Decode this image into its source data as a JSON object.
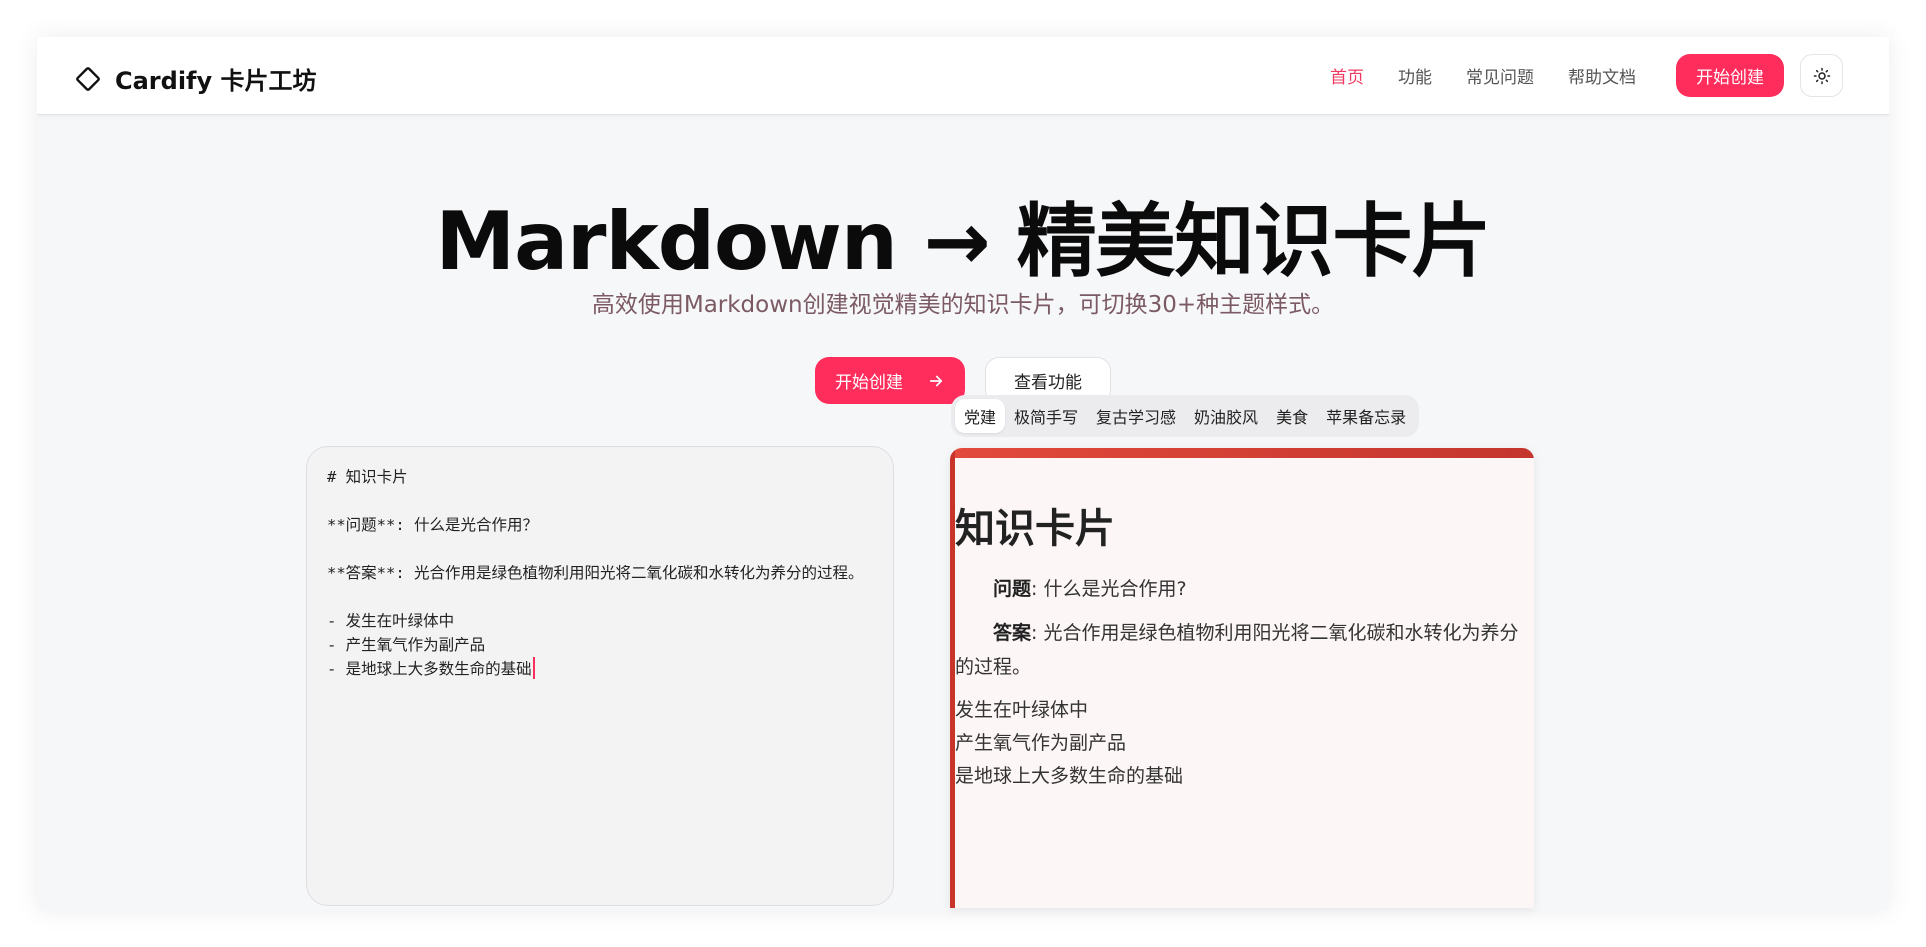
{
  "header": {
    "logo_text": "Cardify 卡片工坊",
    "nav": [
      {
        "label": "首页",
        "active": true
      },
      {
        "label": "功能",
        "active": false
      },
      {
        "label": "常见问题",
        "active": false
      },
      {
        "label": "帮助文档",
        "active": false
      }
    ],
    "cta_label": "开始创建",
    "theme_toggle_icon": "sun-icon"
  },
  "hero": {
    "title": "Markdown → 精美知识卡片",
    "subtitle": "高效使用Markdown创建视觉精美的知识卡片，可切换30+种主题样式。",
    "primary_button": "开始创建",
    "secondary_button": "查看功能"
  },
  "editor": {
    "lines": [
      "# 知识卡片",
      "",
      "**问题**: 什么是光合作用？",
      "",
      "**答案**: 光合作用是绿色植物利用阳光将二氧化碳和水转化为养分的过程。",
      "",
      "- 发生在叶绿体中",
      "- 产生氧气作为副产品",
      "- 是地球上大多数生命的基础"
    ]
  },
  "themes": {
    "tabs": [
      "党建",
      "极简手写",
      "复古学习感",
      "奶油胶风",
      "美食",
      "苹果备忘录"
    ],
    "active_index": 0
  },
  "preview": {
    "title": "知识卡片",
    "question_label": "问题",
    "question_text": ": 什么是光合作用?",
    "answer_label": "答案",
    "answer_text": ": 光合作用是绿色植物利用阳光将二氧化碳和水转化为养分的过程。",
    "bullets": [
      "发生在叶绿体中",
      "产生氧气作为副产品",
      "是地球上大多数生命的基础"
    ]
  },
  "colors": {
    "accent": "#ff2d5c",
    "card_accent": "#c8342a",
    "subtitle": "#7b5a63"
  }
}
